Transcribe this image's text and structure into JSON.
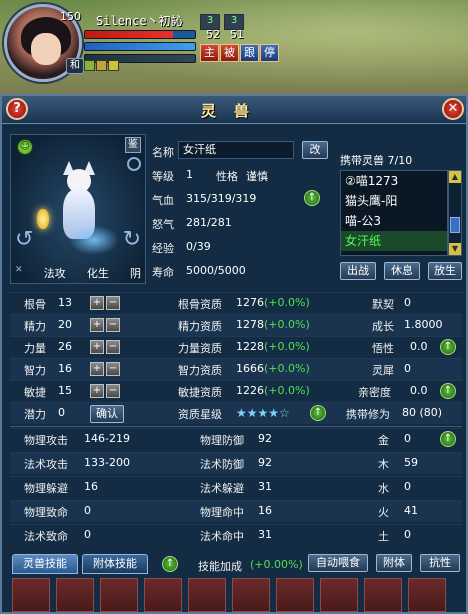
{
  "hud": {
    "level": "150",
    "name": "Silence丶初訫",
    "stat_a": "3",
    "stat_b": "3",
    "num_a": "52",
    "num_b": "51",
    "he_label": "和",
    "buttons": [
      "主",
      "被",
      "跟",
      "停"
    ]
  },
  "window": {
    "title": "灵兽",
    "help": "?",
    "close": "✕"
  },
  "pet_panel": {
    "identify": "鉴",
    "tags": [
      "法攻",
      "化生",
      "阴"
    ]
  },
  "info": {
    "name_label": "名称",
    "name_value": "女汗纸",
    "rename_btn": "改",
    "level_label": "等级",
    "level_value": "1",
    "nature_label": "性格",
    "nature_value": "谨慎",
    "hp_label": "气血",
    "hp_value": "315/319/319",
    "rage_label": "怒气",
    "rage_value": "281/281",
    "exp_label": "经验",
    "exp_value": "0/39",
    "life_label": "寿命",
    "life_value": "5000/5000",
    "carry_label": "携带灵兽",
    "carry_value": "7/10",
    "pet_list": [
      "②喵1273",
      "猫头鹰-阳",
      "喵-公3",
      "女汗纸"
    ],
    "buttons": [
      "出战",
      "休息",
      "放生"
    ]
  },
  "attrs": {
    "rows": [
      {
        "label": "根骨",
        "value": "13",
        "q_label": "根骨资质",
        "q_value": "1276",
        "q_pct": "(+0.0%)",
        "r_label": "默契",
        "r_value": "0"
      },
      {
        "label": "精力",
        "value": "20",
        "q_label": "精力资质",
        "q_value": "1278",
        "q_pct": "(+0.0%)",
        "r_label": "成长",
        "r_value": "1.8000"
      },
      {
        "label": "力量",
        "value": "26",
        "q_label": "力量资质",
        "q_value": "1228",
        "q_pct": "(+0.0%)",
        "r_label": "悟性",
        "r_value": "0.0"
      },
      {
        "label": "智力",
        "value": "16",
        "q_label": "智力资质",
        "q_value": "1666",
        "q_pct": "(+0.0%)",
        "r_label": "灵犀",
        "r_value": "0"
      },
      {
        "label": "敏捷",
        "value": "15",
        "q_label": "敏捷资质",
        "q_value": "1226",
        "q_pct": "(+0.0%)",
        "r_label": "亲密度",
        "r_value": "0.0"
      }
    ],
    "potential_label": "潜力",
    "potential_value": "0",
    "confirm_btn": "确认",
    "star_label": "资质星级",
    "stars": "★★★★☆",
    "carry_cultivation_label": "携带修为",
    "carry_cultivation_value": "80 (80)"
  },
  "combat": {
    "rows": [
      {
        "a_label": "物理攻击",
        "a_value": "146-219",
        "b_label": "物理防御",
        "b_value": "92",
        "c_label": "金",
        "c_value": "0"
      },
      {
        "a_label": "法术攻击",
        "a_value": "133-200",
        "b_label": "法术防御",
        "b_value": "92",
        "c_label": "木",
        "c_value": "59"
      },
      {
        "a_label": "物理躲避",
        "a_value": "16",
        "b_label": "法术躲避",
        "b_value": "31",
        "c_label": "水",
        "c_value": "0"
      },
      {
        "a_label": "物理致命",
        "a_value": "0",
        "b_label": "物理命中",
        "b_value": "16",
        "c_label": "火",
        "c_value": "41"
      },
      {
        "a_label": "法术致命",
        "a_value": "0",
        "b_label": "法术命中",
        "b_value": "31",
        "c_label": "土",
        "c_value": "0"
      }
    ]
  },
  "bottom": {
    "tabs": [
      "灵兽技能",
      "附体技能"
    ],
    "skill_bonus_label": "技能加成",
    "skill_bonus_value": "(+0.00%)",
    "buttons": [
      "自动喂食",
      "附体",
      "抗性"
    ]
  },
  "colors": {
    "panel_bg": "#132c44",
    "accent_green": "#50e050",
    "title_gold": "#ffe8a0"
  }
}
